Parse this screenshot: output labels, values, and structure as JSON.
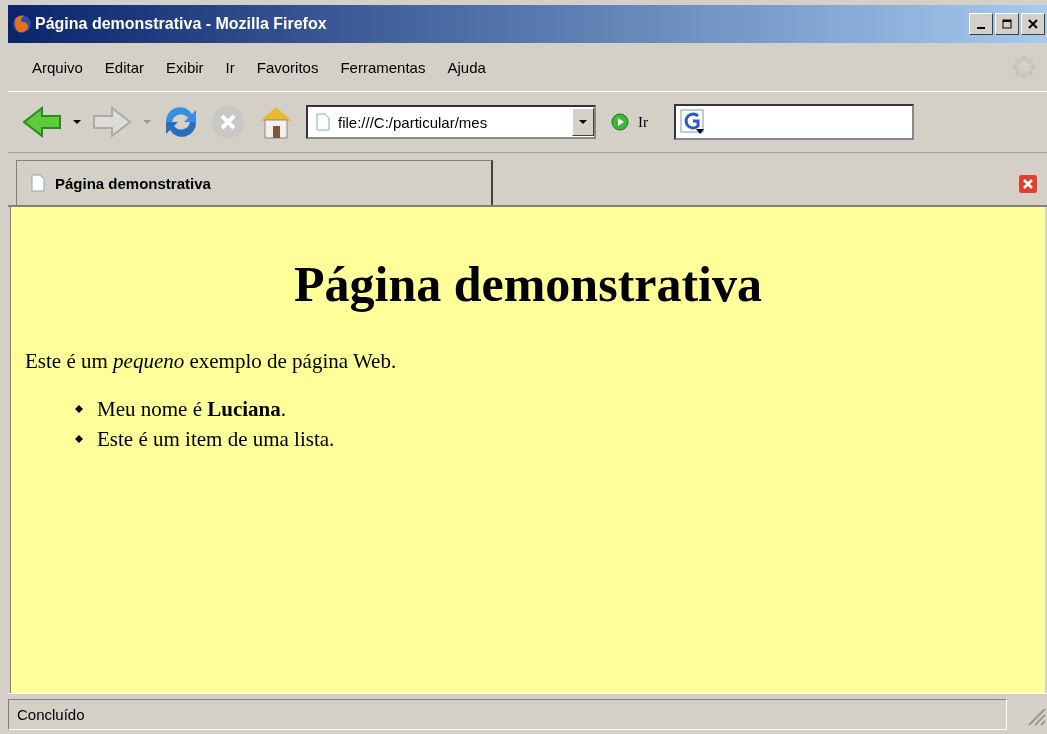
{
  "window": {
    "title": "Página demonstrativa - Mozilla Firefox"
  },
  "menu": [
    "Arquivo",
    "Editar",
    "Exibir",
    "Ir",
    "Favoritos",
    "Ferramentas",
    "Ajuda"
  ],
  "toolbar": {
    "address": "file:///C:/particular/mes",
    "go_label": "Ir"
  },
  "tabs": [
    {
      "label": "Página demonstrativa",
      "selected": true
    }
  ],
  "page": {
    "heading": "Página demonstrativa",
    "paragraph": "Este é um *pequeno* exemplo de página Web.",
    "list": [
      "Meu nome é **Luciana**.",
      "Este é um item de uma lista."
    ]
  },
  "status_bar": "Concluído"
}
